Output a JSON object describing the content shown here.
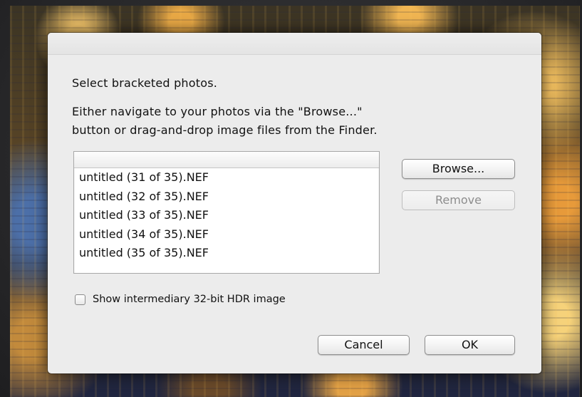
{
  "dialog": {
    "heading": "Select bracketed photos.",
    "instruction_line1": "Either navigate to your photos via the \"Browse...\"",
    "instruction_line2": "button or drag-and-drop image files from the Finder."
  },
  "file_list": {
    "header": "",
    "items": [
      "untitled (31 of 35).NEF",
      "untitled (32 of 35).NEF",
      "untitled (33 of 35).NEF",
      "untitled (34 of 35).NEF",
      "untitled (35 of 35).NEF"
    ]
  },
  "buttons": {
    "browse": "Browse...",
    "remove": "Remove",
    "remove_enabled": false,
    "cancel": "Cancel",
    "ok": "OK"
  },
  "options": {
    "show_hdr_label": "Show intermediary 32-bit HDR image",
    "show_hdr_checked": false
  }
}
